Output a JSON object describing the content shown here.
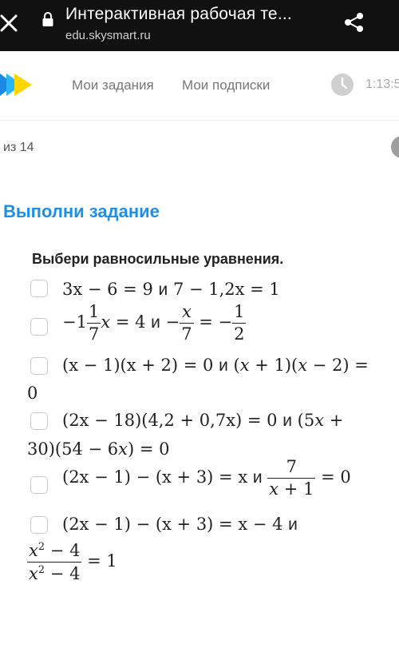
{
  "browser": {
    "title": "Интерактивная рабочая те...",
    "url": "edu.skysmart.ru"
  },
  "nav": {
    "my_tasks": "Мои задания",
    "my_subscriptions": "Мои подписки",
    "timer": "1:13:5"
  },
  "progress": {
    "counter": "из 14"
  },
  "task": {
    "heading": "Выполни задание",
    "prompt": "Выбери равносильные уравнения.",
    "conjunction": "и"
  },
  "options": [
    {
      "left": "3x − 6 = 9",
      "right": "7 − 1,2x = 1"
    },
    {
      "left": "−1 1/7 x = 4",
      "right": "−x/7 = −1/2"
    },
    {
      "left": "(x − 1)(x + 2) = 0",
      "right": "(x + 1)(x − 2) = 0"
    },
    {
      "left": "(2x − 18)(4,2 + 0,7x) = 0",
      "right": "(5x + 30)(54 − 6x) = 0"
    },
    {
      "left": "(2x − 1) − (x + 3) = x",
      "right": "7/(x + 1) = 0"
    },
    {
      "left": "(2x − 1) − (x + 3) = x − 4",
      "right": "(x² − 4)/(x² − 4) = 1"
    }
  ],
  "colors": {
    "accent": "#1e8fe8",
    "topbar": "#111111",
    "checkbox_border": "#c9c9c9"
  }
}
